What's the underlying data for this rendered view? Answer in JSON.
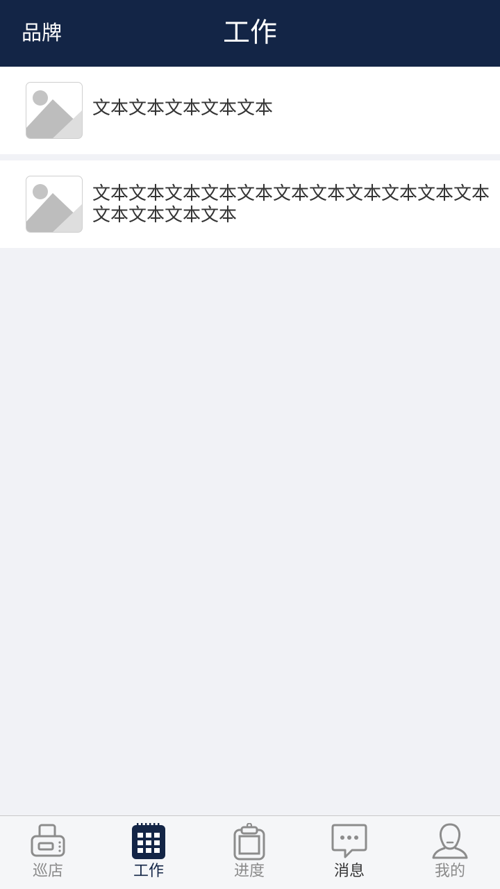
{
  "header": {
    "brand_label": "品牌",
    "title": "工作"
  },
  "list": {
    "items": [
      {
        "text": "文本文本文本文本文本",
        "icon": "image-placeholder-icon"
      },
      {
        "text": "文本文本文本文本文本文本文本文本文本文本文本文本文本文本文本",
        "icon": "image-placeholder-icon"
      }
    ]
  },
  "tabbar": {
    "tabs": [
      {
        "label": "巡店",
        "icon": "printer-icon"
      },
      {
        "label": "工作",
        "icon": "calendar-grid-icon",
        "active": true
      },
      {
        "label": "进度",
        "icon": "clipboard-icon"
      },
      {
        "label": "消息",
        "icon": "chat-bubble-icon"
      },
      {
        "label": "我的",
        "icon": "user-icon"
      }
    ]
  },
  "colors": {
    "header_bg": "#132546",
    "page_bg": "#f1f2f6",
    "active_tab": "#132546",
    "inactive_tab": "#8a8a8a"
  }
}
